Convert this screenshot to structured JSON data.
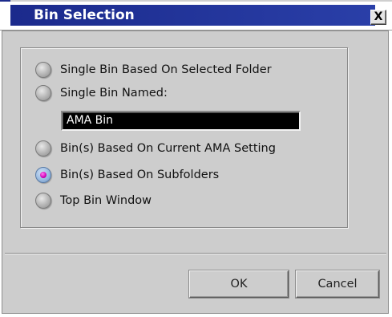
{
  "dialog": {
    "title": "Bin Selection",
    "close_glyph": "X"
  },
  "options": [
    {
      "label": "Single Bin Based On Selected Folder",
      "checked": false
    },
    {
      "label": "Single Bin Named:",
      "checked": false
    },
    {
      "label": "Bin(s) Based On Current AMA Setting",
      "checked": false
    },
    {
      "label": "Bin(s) Based On Subfolders",
      "checked": true
    },
    {
      "label": "Top Bin Window",
      "checked": false
    }
  ],
  "bin_name_field": {
    "value": "AMA Bin"
  },
  "buttons": {
    "ok_label": "OK",
    "cancel_label": "Cancel"
  },
  "colors": {
    "title_bar": "#1b2a8c",
    "panel": "#cdcdcd",
    "selected_dot": "#d100b8"
  }
}
